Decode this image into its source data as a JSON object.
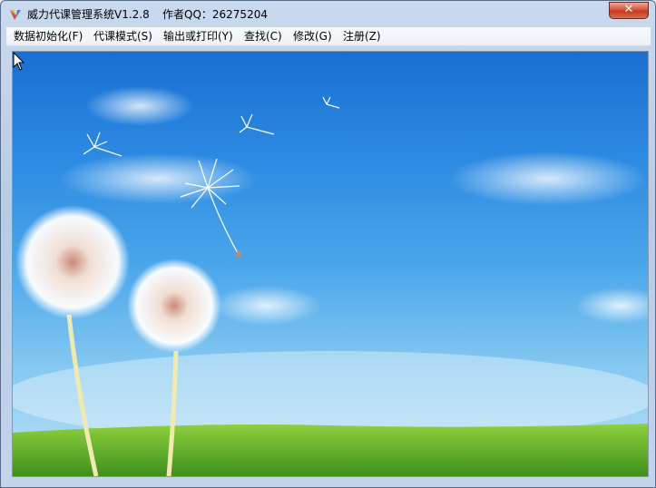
{
  "window": {
    "title": "威力代课管理系统V1.2.8",
    "author_text": "作者QQ：26275204",
    "close_symbol": "✕"
  },
  "menubar": {
    "items": [
      {
        "label": "数据初始化(F)"
      },
      {
        "label": "代课模式(S)"
      },
      {
        "label": "输出或打印(Y)"
      },
      {
        "label": "查找(C)"
      },
      {
        "label": "修改(G)"
      },
      {
        "label": "注册(Z)"
      }
    ]
  },
  "content": {
    "image": "dandelion-sky-wallpaper",
    "colors": {
      "sky_top": "#1a6fd2",
      "sky_bottom": "#b9e0f5",
      "grass": "#6fbf2e"
    }
  },
  "icons": {
    "app": "app-logo-icon",
    "close": "close-icon",
    "cursor": "mouse-pointer-icon"
  }
}
